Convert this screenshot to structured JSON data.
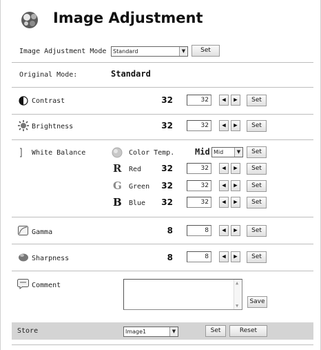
{
  "header": {
    "title": "Image Adjustment",
    "icon": "image-adjustment-icon"
  },
  "mode": {
    "label": "Image Adjustment Mode",
    "selected": "Standard",
    "set_label": "Set"
  },
  "original": {
    "label": "Original Mode:",
    "value": "Standard"
  },
  "contrast": {
    "label": "Contrast",
    "value": "32",
    "input": "32",
    "set_label": "Set",
    "icon": "contrast-icon"
  },
  "brightness": {
    "label": "Brightness",
    "value": "32",
    "input": "32",
    "set_label": "Set",
    "icon": "brightness-icon"
  },
  "white_balance": {
    "label": "White Balance",
    "color_temp": {
      "label": "Color Temp.",
      "value": "Mid",
      "selected": "Mid",
      "set_label": "Set",
      "icon": "color-temp-icon"
    },
    "red": {
      "letter": "R",
      "label": "Red",
      "value": "32",
      "input": "32",
      "set_label": "Set",
      "color": "#2a2a2a"
    },
    "green": {
      "letter": "G",
      "label": "Green",
      "value": "32",
      "input": "32",
      "set_label": "Set",
      "color": "#8a8a8a"
    },
    "blue": {
      "letter": "B",
      "label": "Blue",
      "value": "32",
      "input": "32",
      "set_label": "Set",
      "color": "#111111"
    }
  },
  "gamma": {
    "label": "Gamma",
    "value": "8",
    "input": "8",
    "set_label": "Set",
    "icon": "gamma-icon"
  },
  "sharpness": {
    "label": "Sharpness",
    "value": "8",
    "input": "8",
    "set_label": "Set",
    "icon": "sharpness-icon"
  },
  "comment": {
    "label": "Comment",
    "text": "",
    "save_label": "Save",
    "icon": "comment-icon"
  },
  "store": {
    "label": "Store",
    "selected": "Image1",
    "set_label": "Set",
    "reset_label": "Reset"
  },
  "arrows": {
    "left": "◀",
    "right": "▶",
    "dropdown": "▼"
  },
  "colors": {
    "store_bar": "#d4d4d4",
    "divider": "#bdbdbd"
  }
}
